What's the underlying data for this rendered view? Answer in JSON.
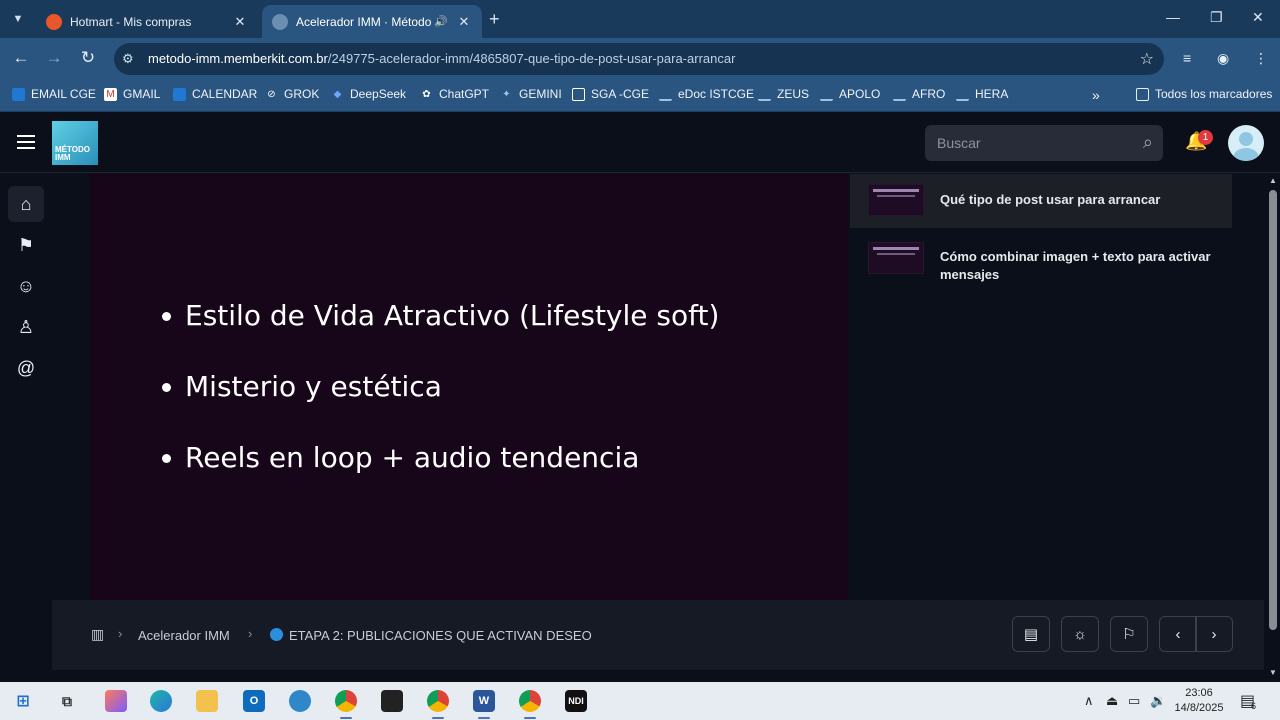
{
  "browser": {
    "tabs": [
      {
        "title": "Hotmart - Mis compras"
      },
      {
        "title": "Acelerador IMM · Método I"
      }
    ],
    "url_host": "metodo-imm.memberkit.com.br",
    "url_path": "/249775-acelerador-imm/4865807-que-tipo-de-post-usar-para-arrancar",
    "bookmarks": [
      "EMAIL CGE",
      "GMAIL",
      "CALENDAR",
      "GROK",
      "DeepSeek",
      "ChatGPT",
      "GEMINI",
      "SGA -CGE",
      "eDoc ISTCGE",
      "ZEUS",
      "APOLO",
      "AFRO",
      "HERA"
    ],
    "all_bookmarks": "Todos los marcadores",
    "overflow": "»"
  },
  "header": {
    "logo_text": "MÉTODO IMM",
    "search_placeholder": "Buscar",
    "notification_count": "1"
  },
  "slide": {
    "bullets": [
      "Estilo de Vida Atractivo (Lifestyle soft)",
      "Misterio y estética",
      "Reels en loop + audio tendencia"
    ]
  },
  "lessons": [
    {
      "title": "Qué tipo de post usar para arrancar",
      "current": true
    },
    {
      "title": "Cómo combinar imagen + texto para activar mensajes",
      "current": false
    }
  ],
  "breadcrumb": {
    "course": "Acelerador IMM",
    "section": "ETAPA 2: PUBLICACIONES QUE ACTIVAN DESEO",
    "section_dot_color": "#2b8fe0"
  },
  "taskbar": {
    "time": "23:06",
    "date": "14/8/2025",
    "notifications": "6"
  },
  "colors": {
    "accent": "#2a5580",
    "slide_bg": "#17061a",
    "badge": "#e0393e"
  }
}
